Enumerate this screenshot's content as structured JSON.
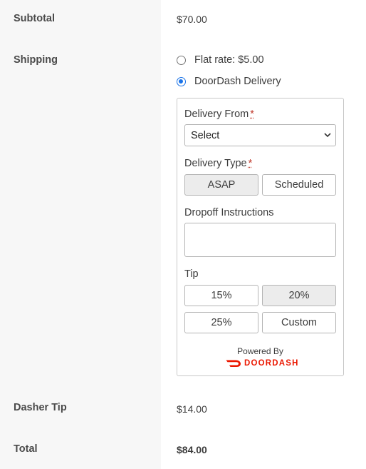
{
  "subtotal": {
    "label": "Subtotal",
    "value": "$70.00"
  },
  "shipping": {
    "label": "Shipping",
    "options": [
      {
        "label": "Flat rate: $5.00",
        "checked": false
      },
      {
        "label": "DoorDash Delivery",
        "checked": true
      }
    ]
  },
  "doordash": {
    "delivery_from": {
      "label": "Delivery From",
      "required": "*",
      "selected": "Select"
    },
    "delivery_type": {
      "label": "Delivery Type",
      "required": "*",
      "options": [
        "ASAP",
        "Scheduled"
      ],
      "selected": "ASAP"
    },
    "dropoff": {
      "label": "Dropoff Instructions",
      "value": ""
    },
    "tip": {
      "label": "Tip",
      "options": [
        "15%",
        "20%",
        "25%",
        "Custom"
      ],
      "selected": "20%"
    },
    "powered_by": "Powered By",
    "brand": "DOORDASH",
    "brand_color": "#eb1700"
  },
  "dasher_tip": {
    "label": "Dasher Tip",
    "value": "$14.00"
  },
  "total": {
    "label": "Total",
    "value": "$84.00"
  },
  "colors": {
    "accent": "#1a73e8",
    "brand": "#eb1700",
    "label_bg": "#f7f7f7"
  }
}
